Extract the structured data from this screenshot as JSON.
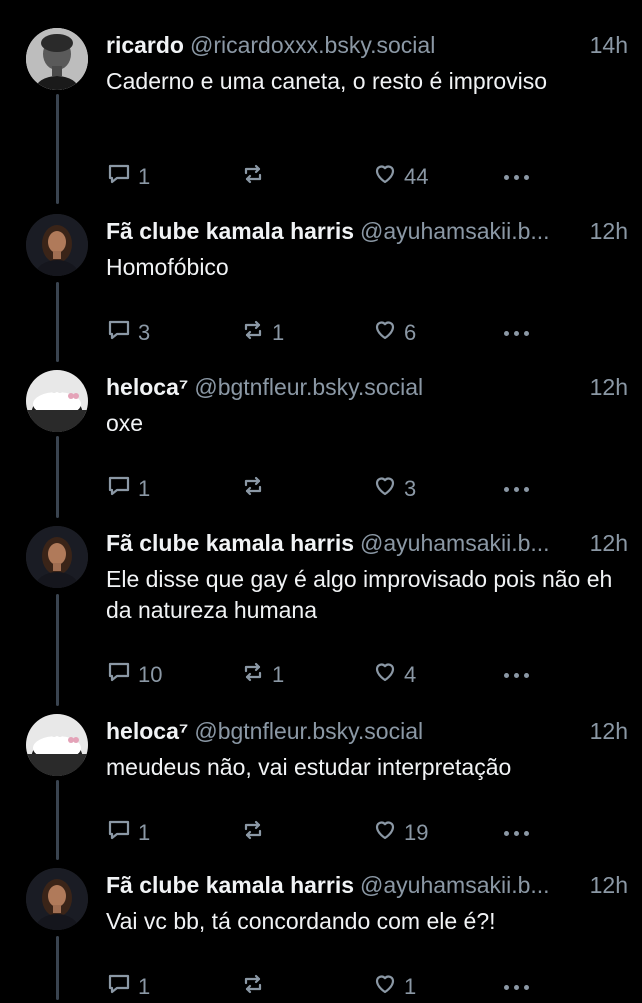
{
  "posts": [
    {
      "name": "ricardo",
      "handle": "@ricardoxxx.bsky.social",
      "time": "14h",
      "text": "Caderno e uma caneta, o resto é improviso",
      "replies": "1",
      "reposts": "",
      "likes": "44",
      "avatar": "avatar-ricardo"
    },
    {
      "name": "Fã clube kamala harris",
      "handle": "@ayuhamsakii.b...",
      "time": "12h",
      "text": "Homofóbico",
      "replies": "3",
      "reposts": "1",
      "likes": "6",
      "avatar": "avatar-kamala"
    },
    {
      "name": "heloca⁷",
      "handle": "@bgtnfleur.bsky.social",
      "time": "12h",
      "text": "oxe",
      "replies": "1",
      "reposts": "",
      "likes": "3",
      "avatar": "avatar-heloca"
    },
    {
      "name": "Fã clube kamala harris",
      "handle": "@ayuhamsakii.b...",
      "time": "12h",
      "text": "Ele disse que gay é algo improvisado pois não eh da natureza humana",
      "replies": "10",
      "reposts": "1",
      "likes": "4",
      "avatar": "avatar-kamala"
    },
    {
      "name": "heloca⁷",
      "handle": "@bgtnfleur.bsky.social",
      "time": "12h",
      "text": "meudeus não, vai estudar interpretação",
      "replies": "1",
      "reposts": "",
      "likes": "19",
      "avatar": "avatar-heloca"
    },
    {
      "name": "Fã clube kamala harris",
      "handle": "@ayuhamsakii.b...",
      "time": "12h",
      "text": "Vai vc bb, tá concordando com ele é?!",
      "replies": "1",
      "reposts": "",
      "likes": "1",
      "avatar": "avatar-kamala"
    }
  ],
  "icons": {
    "reply": "reply-icon",
    "repost": "repost-icon",
    "like": "heart-icon",
    "more": "more-dots-icon"
  },
  "colors": {
    "background": "#000000",
    "text": "#f1f3f5",
    "muted": "#8b98a5",
    "thread_line": "#3a4450"
  }
}
